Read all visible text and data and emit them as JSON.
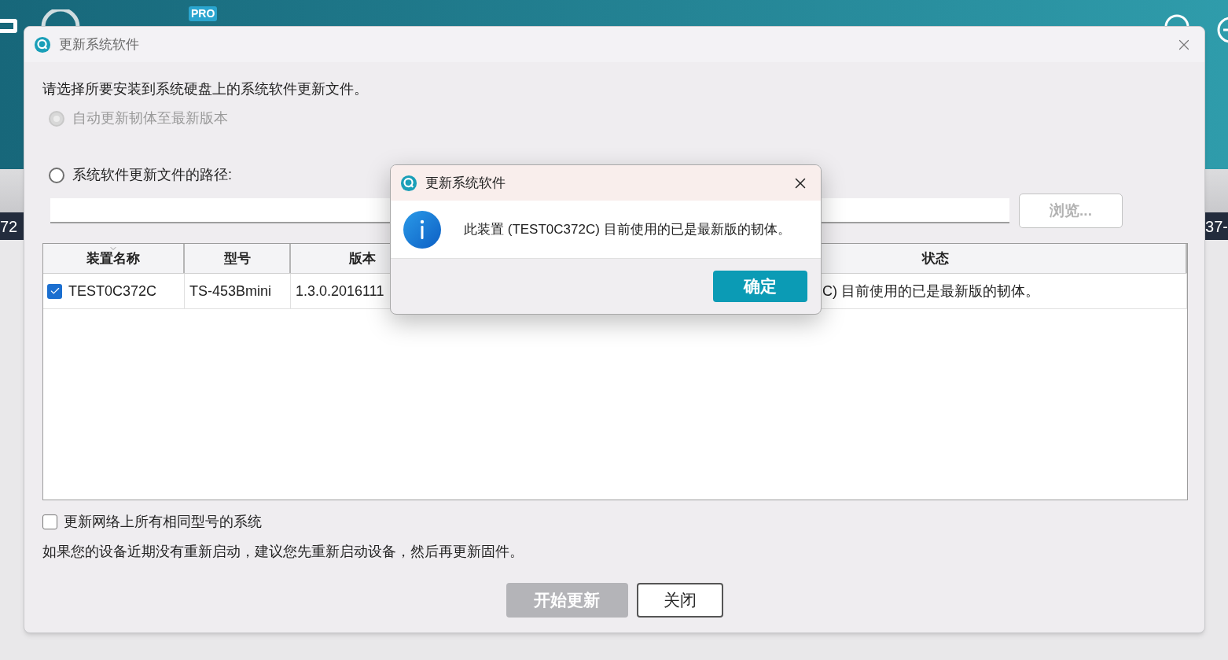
{
  "background_app": {
    "badge": "PRO",
    "left_fragment": "72",
    "right_fragment": "37-"
  },
  "window": {
    "title": "更新系统软件"
  },
  "instruction": "请选择所要安装到系统硬盘上的系统软件更新文件。",
  "options": [
    {
      "label": "自动更新韧体至最新版本",
      "selected": false,
      "disabled": true
    },
    {
      "label": "系统软件更新文件的路径:",
      "selected": false,
      "disabled": false
    }
  ],
  "browse_button": {
    "label": "浏览...",
    "disabled": true
  },
  "table": {
    "columns": [
      {
        "label": "装置名称",
        "sorted": true
      },
      {
        "label": "型号",
        "sorted": false
      },
      {
        "label": "版本",
        "sorted": false
      },
      {
        "label": "状态",
        "sorted": false
      }
    ],
    "rows": [
      {
        "checked": true,
        "cells": [
          "TEST0C372C",
          "TS-453Bmini",
          "1.3.0.2016111",
          "C) 目前使用的已是最新版的韧体。"
        ]
      }
    ]
  },
  "update_all": {
    "label": "更新网络上所有相同型号的系统",
    "checked": false
  },
  "note": "如果您的设备近期没有重新启动，建议您先重新启动设备，然后再更新固件。",
  "buttons": [
    {
      "label": "开始更新",
      "disabled": true
    },
    {
      "label": "关闭",
      "disabled": false
    }
  ],
  "modal": {
    "title": "更新系统软件",
    "message": "此装置 (TEST0C372C) 目前使用的已是最新版的韧体。",
    "button": "确定"
  }
}
